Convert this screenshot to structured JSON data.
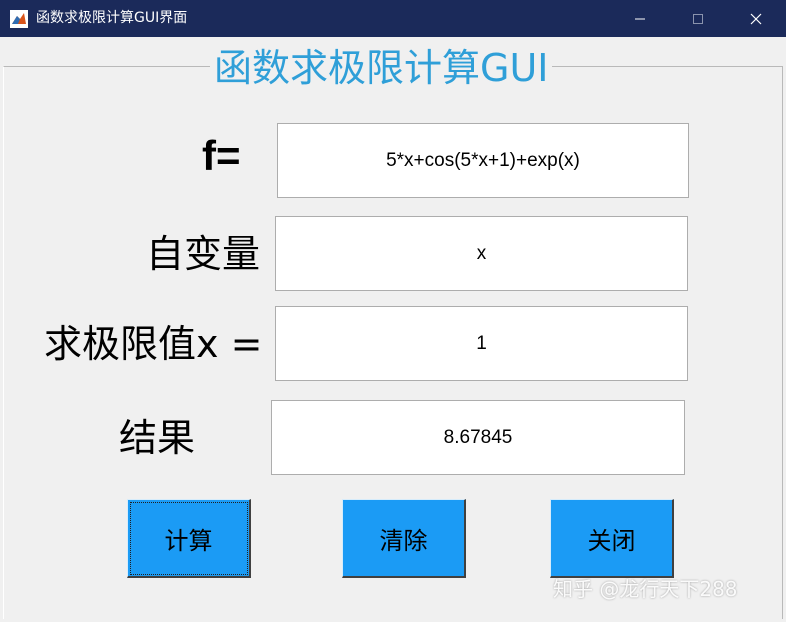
{
  "window": {
    "title": "函数求极限计算GUI界面",
    "controls": [
      "minimize",
      "maximize",
      "close"
    ]
  },
  "panel": {
    "title": "函数求极限计算GUI"
  },
  "form": {
    "function_label": "f=",
    "function_value": "5*x+cos(5*x+1)+exp(x)",
    "variable_label": "自变量",
    "variable_value": "x",
    "limit_label": "求极限值x =",
    "limit_value": "1",
    "result_label": "结果",
    "result_value": "8.67845"
  },
  "buttons": {
    "calculate": "计算",
    "clear": "清除",
    "close": "关闭"
  },
  "watermark": "知乎 @龙行天下288",
  "colors": {
    "titlebar": "#1b2a5a",
    "panel_title": "#2f9fd8",
    "button": "#1b9bf5",
    "background": "#f0f0f0"
  },
  "icons": {
    "app": "matlab-icon",
    "minimize": "minimize-icon",
    "maximize": "maximize-icon",
    "close": "close-icon"
  }
}
